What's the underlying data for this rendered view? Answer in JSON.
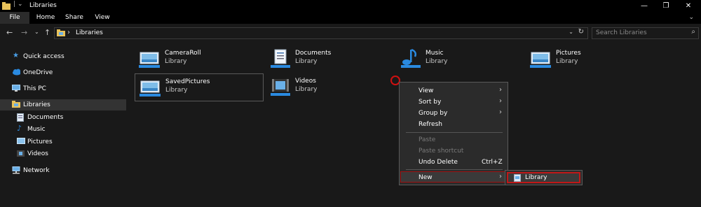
{
  "window": {
    "title": "Libraries",
    "controls": {
      "minimize": "—",
      "restore": "❐",
      "close": "✕"
    }
  },
  "ribbon": {
    "tabs": [
      "File",
      "Home",
      "Share",
      "View"
    ],
    "expand_glyph": "⌄",
    "help_glyph": "?"
  },
  "navigation": {
    "back": "←",
    "forward": "→",
    "recent": "⌄",
    "up": "↑",
    "address_chevron": "›",
    "address_path": "Libraries",
    "address_dropdown": "⌄",
    "refresh": "↻",
    "search_placeholder": "Search Libraries",
    "search_glyph": "⌕"
  },
  "sidebar": {
    "items": [
      {
        "label": "Quick access",
        "icon": "star-icon"
      },
      {
        "label": "OneDrive",
        "icon": "cloud-icon"
      },
      {
        "label": "This PC",
        "icon": "computer-icon"
      },
      {
        "label": "Libraries",
        "icon": "libraries-folder-icon",
        "selected": true
      },
      {
        "label": "Documents",
        "icon": "documents-library-icon"
      },
      {
        "label": "Music",
        "icon": "music-library-icon"
      },
      {
        "label": "Pictures",
        "icon": "pictures-library-icon"
      },
      {
        "label": "Videos",
        "icon": "videos-library-icon"
      },
      {
        "label": "Network",
        "icon": "network-icon"
      }
    ]
  },
  "libraries": [
    {
      "name": "CameraRoll",
      "type": "Library",
      "icon": "pictures-library-icon"
    },
    {
      "name": "Documents",
      "type": "Library",
      "icon": "documents-library-icon"
    },
    {
      "name": "Music",
      "type": "Library",
      "icon": "music-library-icon"
    },
    {
      "name": "Pictures",
      "type": "Library",
      "icon": "pictures-library-icon"
    },
    {
      "name": "SavedPictures",
      "type": "Library",
      "icon": "pictures-library-icon"
    },
    {
      "name": "Videos",
      "type": "Library",
      "icon": "videos-library-icon"
    }
  ],
  "context_menu": {
    "items": [
      {
        "label": "View",
        "submenu": true
      },
      {
        "label": "Sort by",
        "submenu": true
      },
      {
        "label": "Group by",
        "submenu": true
      },
      {
        "label": "Refresh"
      },
      {
        "label": "Paste",
        "disabled": true
      },
      {
        "label": "Paste shortcut",
        "disabled": true
      },
      {
        "label": "Undo Delete",
        "shortcut": "Ctrl+Z"
      },
      {
        "label": "New",
        "submenu": true,
        "highlighted": true
      }
    ],
    "arrow": "›",
    "submenu_items": [
      {
        "label": "Library",
        "icon": "library-icon",
        "highlighted": true
      }
    ]
  },
  "colors": {
    "background": "#191919",
    "titlebar": "#000000",
    "menu_background": "#2b2b2b",
    "highlight_border": "#c01818",
    "accent_blue": "#1e90ff"
  }
}
